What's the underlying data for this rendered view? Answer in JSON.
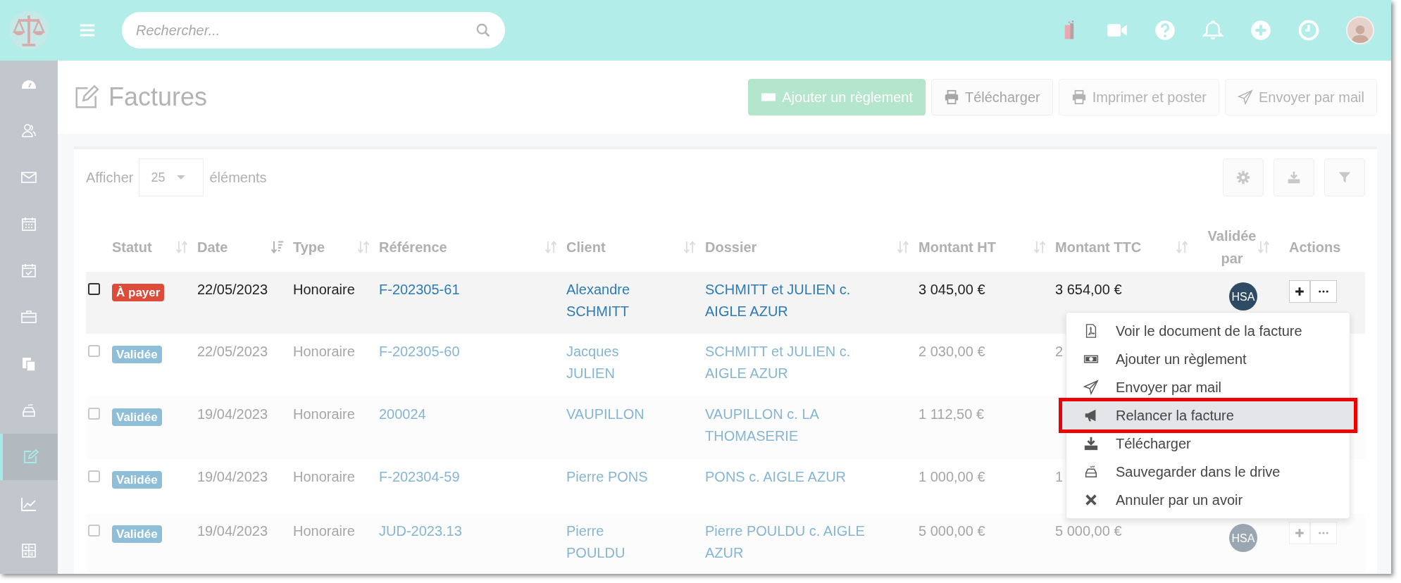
{
  "header": {
    "search": {
      "placeholder": "Rechercher..."
    }
  },
  "sidebar": {
    "items": [
      {
        "selected": false
      },
      {
        "selected": false
      },
      {
        "selected": false
      },
      {
        "selected": false
      },
      {
        "selected": false
      },
      {
        "selected": false
      },
      {
        "selected": false
      },
      {
        "selected": false
      },
      {
        "selected": true
      },
      {
        "selected": false
      },
      {
        "selected": false
      }
    ]
  },
  "page": {
    "title": "Factures",
    "buttons": [
      {
        "label": "Ajouter un règlement",
        "kind": "primary"
      },
      {
        "label": "Télécharger",
        "kind": "default"
      },
      {
        "label": "Imprimer et poster",
        "kind": "disabled"
      },
      {
        "label": "Envoyer par mail",
        "kind": "disabled"
      }
    ]
  },
  "table": {
    "length": {
      "before": "Afficher",
      "value": "25",
      "after": "éléments"
    },
    "columns": [
      {
        "label": "Statut",
        "sorted": false
      },
      {
        "label": "Date",
        "sorted": true
      },
      {
        "label": "Type",
        "sorted": false
      },
      {
        "label": "Référence",
        "sorted": false
      },
      {
        "label": "Client",
        "sorted": false
      },
      {
        "label": "Dossier",
        "sorted": false
      },
      {
        "label": "Montant HT",
        "sorted": false
      },
      {
        "label": "Montant TTC",
        "sorted": false
      },
      {
        "label": "Validée par",
        "sorted": false
      },
      {
        "label": "Actions"
      }
    ],
    "rows": [
      {
        "checked": false,
        "faded": false,
        "status": {
          "label": "À payer",
          "kind": "unpaid"
        },
        "date": "22/05/2023",
        "type": "Honoraire",
        "reference": "F-202305-61",
        "client": "Alexandre SCHMITT",
        "dossier": "SCHMITT et JULIEN c. AIGLE AZUR",
        "ht": "3 045,00 €",
        "ttc": "3 654,00 €",
        "validated_by": "HSA",
        "actions": true
      },
      {
        "checked": false,
        "faded": true,
        "status": {
          "label": "Validée",
          "kind": "validated"
        },
        "date": "22/05/2023",
        "type": "Honoraire",
        "reference": "F-202305-60",
        "client": "Jacques JULIEN",
        "dossier": "SCHMITT et JULIEN c. AIGLE AZUR",
        "ht": "2 030,00 €",
        "ttc": "2"
      },
      {
        "checked": false,
        "faded": true,
        "status": {
          "label": "Validée",
          "kind": "validated"
        },
        "date": "19/04/2023",
        "type": "Honoraire",
        "reference": "200024",
        "client": "VAUPILLON",
        "dossier": "VAUPILLON c. LA THOMASERIE",
        "ht": "1 112,50 €"
      },
      {
        "checked": false,
        "faded": true,
        "status": {
          "label": "Validée",
          "kind": "validated"
        },
        "date": "19/04/2023",
        "type": "Honoraire",
        "reference": "F-202304-59",
        "client": "Pierre PONS",
        "dossier": "PONS c. AIGLE AZUR",
        "ht": "1 000,00 €",
        "ttc": "1"
      },
      {
        "checked": false,
        "faded": true,
        "status": {
          "label": "Validée",
          "kind": "validated"
        },
        "date": "19/04/2023",
        "type": "Honoraire",
        "reference": "JUD-2023.13",
        "client": "Pierre POULDU",
        "dossier": "Pierre POULDU c. AIGLE AZUR",
        "ht": "5 000,00 €",
        "ttc": "5 000,00 €",
        "validated_by": "HSA",
        "actions": true
      }
    ]
  },
  "actions_menu": {
    "items": [
      {
        "label": "Voir le document de la facture",
        "highlighted": false
      },
      {
        "label": "Ajouter un règlement",
        "highlighted": false
      },
      {
        "label": "Envoyer par mail",
        "highlighted": false
      },
      {
        "label": "Relancer la facture",
        "highlighted": true
      },
      {
        "label": "Télécharger",
        "highlighted": false
      },
      {
        "label": "Sauvegarder dans le drive",
        "highlighted": false
      },
      {
        "label": "Annuler par un avoir",
        "highlighted": false
      }
    ]
  }
}
